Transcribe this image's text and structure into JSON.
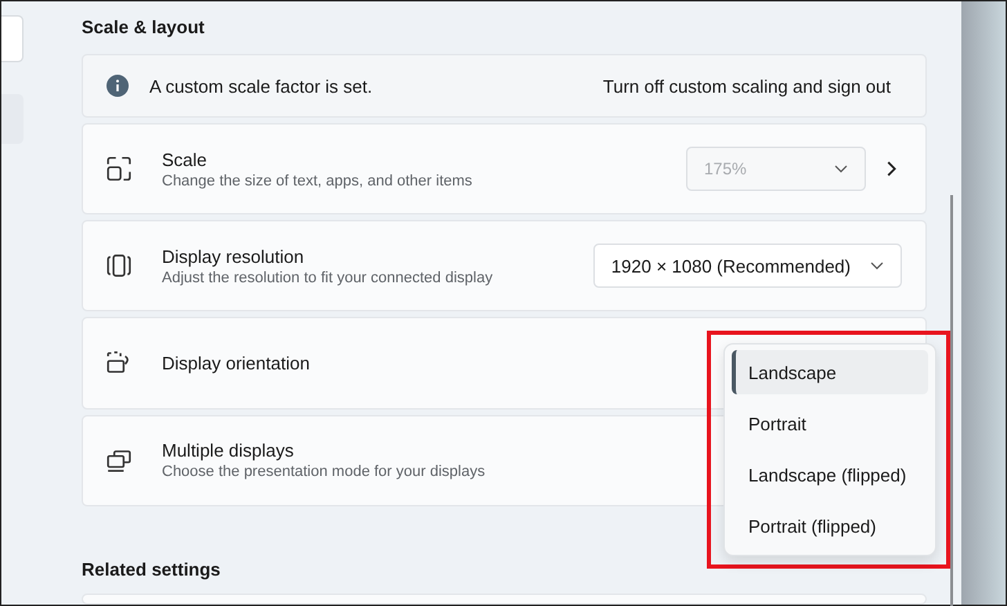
{
  "section_title": "Scale & layout",
  "notice": {
    "text": "A custom scale factor is set.",
    "action": "Turn off custom scaling and sign out"
  },
  "settings": [
    {
      "title": "Scale",
      "description": "Change the size of text, apps, and other items",
      "kind": "select",
      "value": "175%",
      "disabled": true,
      "chevron": true
    },
    {
      "title": "Display resolution",
      "description": "Adjust the resolution to fit your connected display",
      "kind": "select",
      "value": "1920 × 1080 (Recommended)",
      "disabled": false,
      "chevron": false
    },
    {
      "title": "Display orientation",
      "kind": "menu"
    },
    {
      "title": "Multiple displays",
      "description": "Choose the presentation mode for your displays",
      "kind": "plain"
    }
  ],
  "orientation_menu": [
    {
      "label": "Landscape",
      "selected": true
    },
    {
      "label": "Portrait",
      "selected": false
    },
    {
      "label": "Landscape (flipped)",
      "selected": false
    },
    {
      "label": "Portrait (flipped)",
      "selected": false
    }
  ],
  "related_title": "Related settings"
}
